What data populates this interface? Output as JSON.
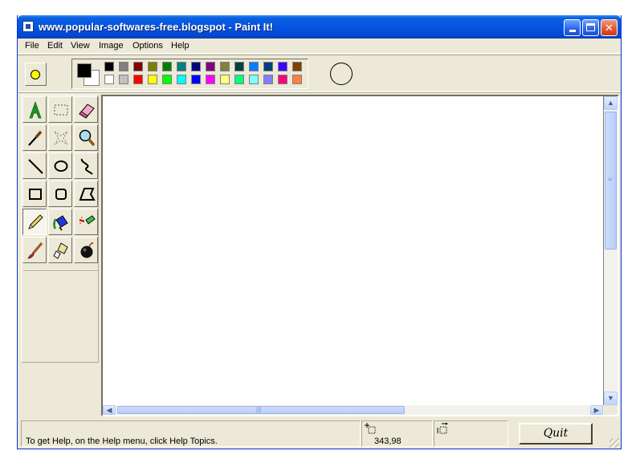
{
  "window": {
    "title": "www.popular-softwares-free.blogspot - Paint It!",
    "app_icon": "paint-app-icon"
  },
  "titlebar_buttons": {
    "minimize": "minimize-icon",
    "maximize": "maximize-icon",
    "close_label": "✕"
  },
  "menu": [
    "File",
    "Edit",
    "View",
    "Image",
    "Options",
    "Help"
  ],
  "toolbar": {
    "brush_color": "#ffff00",
    "foreground_color": "#000000",
    "background_color": "#ffffff",
    "palette_row1": [
      "#000000",
      "#808080",
      "#800000",
      "#808000",
      "#008000",
      "#008080",
      "#000080",
      "#800080",
      "#808040",
      "#004040",
      "#0080ff",
      "#004080",
      "#4000ff",
      "#804000"
    ],
    "palette_row2": [
      "#ffffff",
      "#c0c0c0",
      "#ff0000",
      "#ffff00",
      "#00ff00",
      "#00ffff",
      "#0000ff",
      "#ff00ff",
      "#ffff80",
      "#00ff80",
      "#80ffff",
      "#8080ff",
      "#ff0080",
      "#ff8040"
    ]
  },
  "tools": [
    [
      "text-tool-icon",
      "rect-select-icon",
      "eraser-icon"
    ],
    [
      "eyedropper-icon",
      "free-select-icon",
      "magnifier-icon"
    ],
    [
      "line-icon",
      "ellipse-icon",
      "curve-icon"
    ],
    [
      "rectangle-icon",
      "rounded-rect-icon",
      "polygon-icon"
    ],
    [
      "pencil-icon",
      "fill-bucket-icon",
      "airbrush-icon"
    ],
    [
      "brush-icon",
      "stamp-icon",
      "bomb-icon"
    ]
  ],
  "selected_tool": "pencil-icon",
  "status": {
    "help_text": "To get Help, on the Help menu, click Help Topics.",
    "coordinates": "343,98",
    "quit_label": "Quit"
  }
}
